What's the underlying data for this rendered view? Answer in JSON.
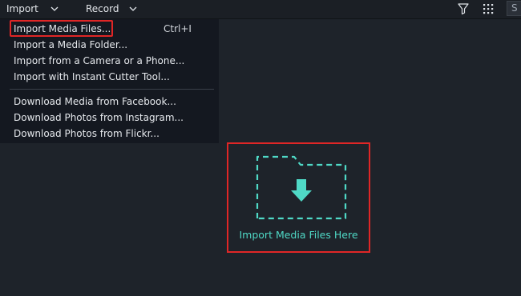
{
  "toolbar": {
    "import_label": "Import",
    "record_label": "Record",
    "icons": [
      "filter-icon",
      "grid-icon"
    ],
    "search_initial": "S"
  },
  "import_menu": {
    "items": [
      {
        "label": "Import Media Files...",
        "shortcut": "Ctrl+I",
        "highlighted": true
      },
      {
        "label": "Import a Media Folder..."
      },
      {
        "label": "Import from a Camera or a Phone..."
      },
      {
        "label": "Import with Instant Cutter Tool..."
      },
      {
        "label": "Download Media from Facebook..."
      },
      {
        "label": "Download Photos from Instagram..."
      },
      {
        "label": "Download Photos from Flickr..."
      }
    ]
  },
  "drop_zone": {
    "label": "Import Media Files Here",
    "accent": "#4fd9c6"
  },
  "colors": {
    "background": "#1e232a",
    "menu_bg": "#141820",
    "highlight_border": "#e02626"
  }
}
